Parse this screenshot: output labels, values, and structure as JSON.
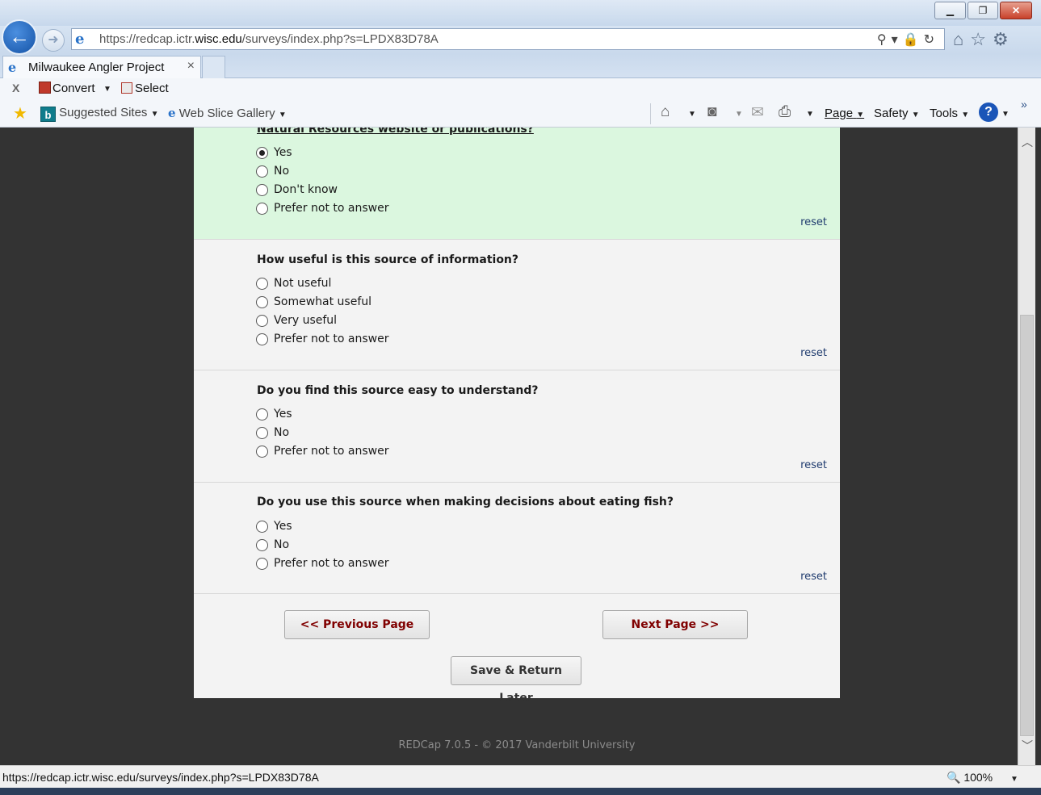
{
  "window": {
    "minimize_icon": "minimize-icon",
    "restore_icon": "restore-icon",
    "close_label": "✕"
  },
  "navbar": {
    "url_prefix": "https://redcap.ictr.",
    "url_host": "wisc.edu",
    "url_suffix": "/surveys/index.php?s=LPDX83D78A"
  },
  "tab": {
    "title": "Milwaukee Angler Project",
    "close_label": "×"
  },
  "command_bar": {
    "convert_label": "Convert",
    "select_label": "Select",
    "suggested_sites_label": "Suggested Sites",
    "web_slice_label": "Web Slice Gallery",
    "page_label": "Page",
    "safety_label": "Safety",
    "tools_label": "Tools"
  },
  "survey": {
    "questions": [
      {
        "text": "Natural Resources website or publications?",
        "options": [
          "Yes",
          "No",
          "Don't know",
          "Prefer not to answer"
        ],
        "selected": 0,
        "reset_label": "reset"
      },
      {
        "text": "How useful is this source of information?",
        "options": [
          "Not useful",
          "Somewhat useful",
          "Very useful",
          "Prefer not to answer"
        ],
        "selected": null,
        "reset_label": "reset"
      },
      {
        "text": "Do you find this source easy to understand?",
        "options": [
          "Yes",
          "No",
          "Prefer not to answer"
        ],
        "selected": null,
        "reset_label": "reset"
      },
      {
        "text": "Do you use this source when making decisions about eating fish?",
        "options": [
          "Yes",
          "No",
          "Prefer not to answer"
        ],
        "selected": null,
        "reset_label": "reset"
      }
    ],
    "prev_button": "<< Previous Page",
    "next_button": "Next Page >>",
    "save_button": "Save & Return Later"
  },
  "footer": {
    "text": "REDCap 7.0.5 - © 2017 Vanderbilt University"
  },
  "statusbar": {
    "url": "https://redcap.ictr.wisc.edu/surveys/index.php?s=LPDX83D78A",
    "zoom": "100%"
  },
  "colors": {
    "active_question_bg": "#dbf7df",
    "nav_button_text": "#800000",
    "reset_link": "#1f3b6e"
  }
}
